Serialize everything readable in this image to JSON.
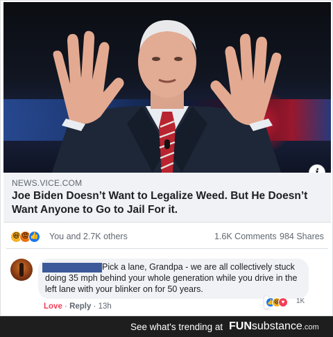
{
  "post": {
    "link": {
      "domain": "NEWS.VICE.COM",
      "headline": "Joe Biden Doesn’t Want to Legalize Weed. But He Doesn’t Want Anyone to Go to Jail For it."
    },
    "stats": {
      "reactions_text": "You and 2.7K others",
      "comments": "1.6K Comments",
      "shares": "984 Shares",
      "reaction_icons": [
        "haha-icon",
        "angry-icon",
        "like-icon"
      ]
    }
  },
  "comment": {
    "text": "Pick a lane, Grandpa - we are all collectively stuck doing 35 mph behind your whole generation while you drive in the left lane with your blinker on for 50 years.",
    "reaction_count": "1K",
    "actions": {
      "love": "Love",
      "reply": "Reply",
      "time": "13h"
    }
  },
  "footer": {
    "trending_text": "See what's trending at",
    "brand_fun": "FUN",
    "brand_sub": "substance",
    "brand_com": ".com"
  },
  "colors": {
    "facebook_blue": "#1877f2",
    "love_red": "#f33e58",
    "text_gray": "#606770"
  }
}
